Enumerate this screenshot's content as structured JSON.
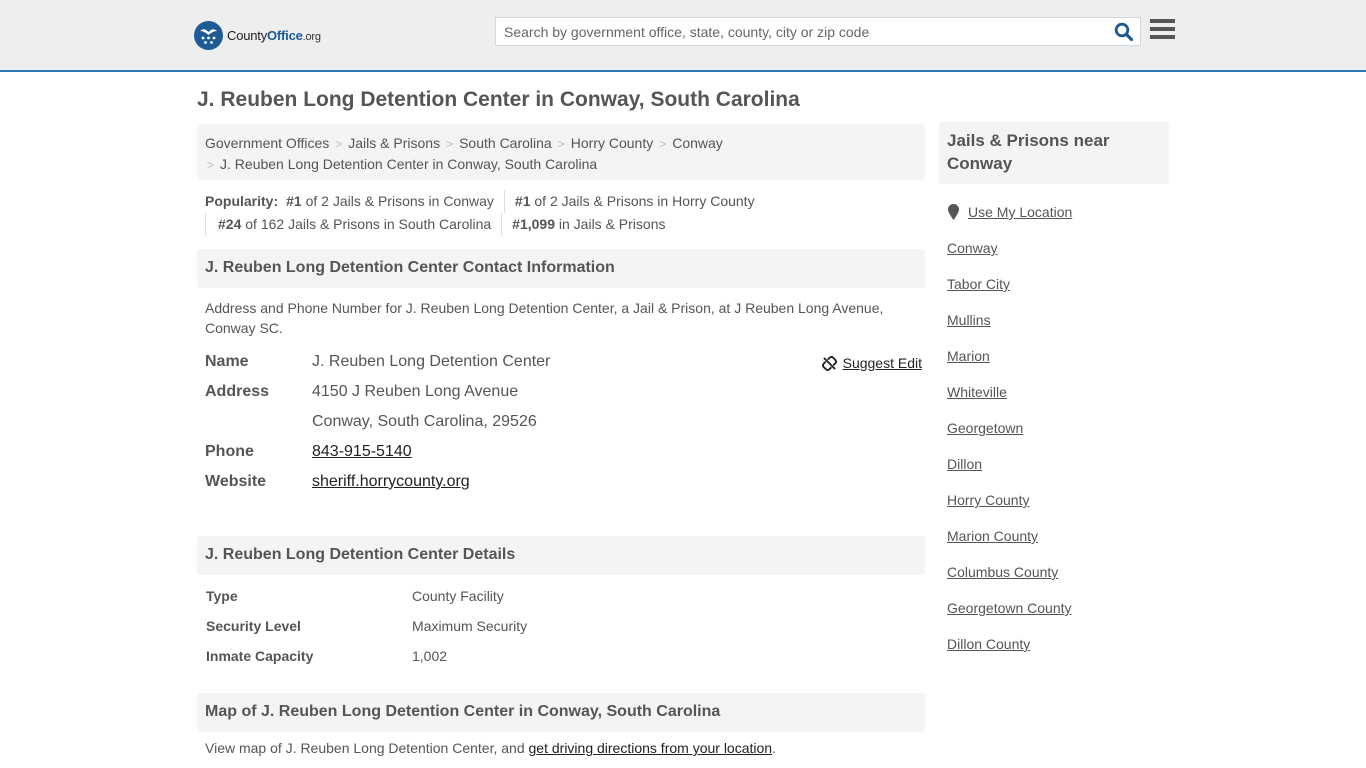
{
  "header": {
    "logo": {
      "county": "County",
      "office": "Office",
      "org": ".org"
    },
    "search_placeholder": "Search by government office, state, county, city or zip code",
    "search_icon": "search-icon",
    "menu_icon": "hamburger-menu-icon"
  },
  "page": {
    "title": "J. Reuben Long Detention Center in Conway, South Carolina"
  },
  "breadcrumb": {
    "items": [
      "Government Offices",
      "Jails & Prisons",
      "South Carolina",
      "Horry County",
      "Conway"
    ],
    "current": "J. Reuben Long Detention Center in Conway, South Carolina",
    "separator": ">"
  },
  "popularity": {
    "label": "Popularity:",
    "ranks": [
      {
        "rank": "#1",
        "text": " of 2 Jails & Prisons in Conway"
      },
      {
        "rank": "#1",
        "text": " of 2 Jails & Prisons in Horry County"
      },
      {
        "rank": "#24",
        "text": " of 162 Jails & Prisons in South Carolina"
      },
      {
        "rank": "#1,099",
        "text": " in Jails & Prisons"
      }
    ]
  },
  "contact": {
    "heading": "J. Reuben Long Detention Center Contact Information",
    "description": "Address and Phone Number for J. Reuben Long Detention Center, a Jail & Prison, at J Reuben Long Avenue, Conway SC.",
    "suggest_edit": "Suggest Edit",
    "fields": {
      "name_label": "Name",
      "name": "J. Reuben Long Detention Center",
      "address_label": "Address",
      "address_line1": "4150 J Reuben Long Avenue",
      "address_line2": "Conway, South Carolina, 29526",
      "phone_label": "Phone",
      "phone": "843-915-5140",
      "website_label": "Website",
      "website": "sheriff.horrycounty.org"
    }
  },
  "details": {
    "heading": "J. Reuben Long Detention Center Details",
    "rows": [
      {
        "label": "Type",
        "value": "County Facility"
      },
      {
        "label": "Security Level",
        "value": "Maximum Security"
      },
      {
        "label": "Inmate Capacity",
        "value": "1,002"
      }
    ]
  },
  "map": {
    "heading": "Map of J. Reuben Long Detention Center in Conway, South Carolina",
    "text_before": "View map of J. Reuben Long Detention Center, and ",
    "link": "get driving directions from your location",
    "text_after": "."
  },
  "sidebar": {
    "heading": "Jails & Prisons near Conway",
    "use_location": "Use My Location",
    "links": [
      "Conway",
      "Tabor City",
      "Mullins",
      "Marion",
      "Whiteville",
      "Georgetown",
      "Dillon",
      "Horry County",
      "Marion County",
      "Columbus County",
      "Georgetown County",
      "Dillon County"
    ]
  },
  "colors": {
    "brand_blue": "#1d5a96",
    "header_border": "#3178b1",
    "header_bg": "#eeeeee",
    "panel_bg": "#f4f4f4",
    "text": "#555555"
  }
}
